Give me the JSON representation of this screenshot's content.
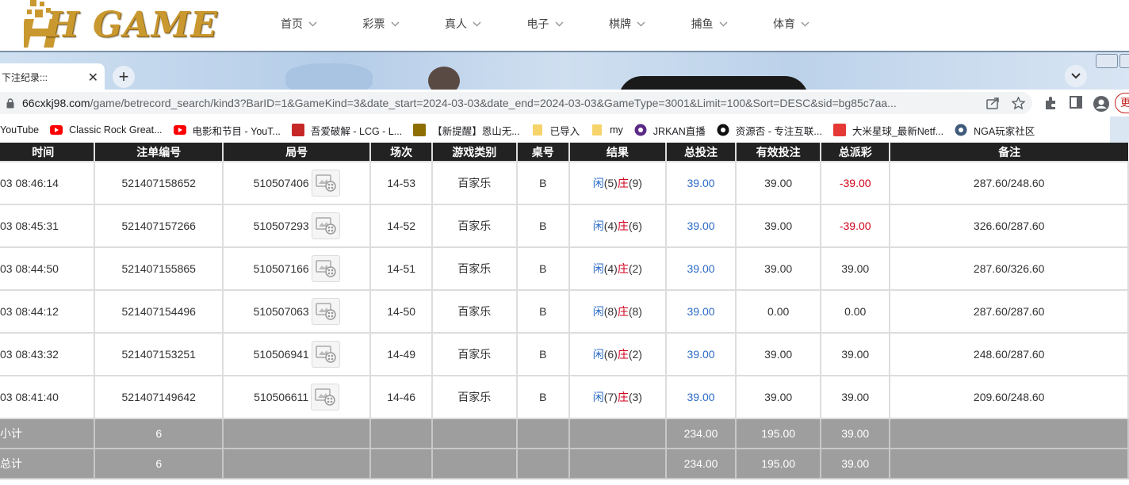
{
  "site": {
    "logo_text": "H GAME",
    "nav": [
      "首页",
      "彩票",
      "真人",
      "电子",
      "棋牌",
      "捕鱼",
      "体育"
    ]
  },
  "browser": {
    "tab_title": "下注纪录:::",
    "url_host": "66cxkj98.com",
    "url_path": "/game/betrecord_search/kind3?BarID=1&GameKind=3&date_start=2024-03-03&date_end=2024-03-03&GameType=3001&Limit=100&Sort=DESC&sid=bg85c7aa...",
    "profile_label": "更",
    "bookmarks": [
      {
        "icon": "youtube-icon",
        "label": "YouTube",
        "color": "#ff0000"
      },
      {
        "icon": "youtube-icon",
        "label": "Classic Rock Great...",
        "color": "#ff0000"
      },
      {
        "icon": "youtube-icon",
        "label": "电影和节目 - YouT...",
        "color": "#ff0000"
      },
      {
        "icon": "lcg-icon",
        "label": "吾爱破解 - LCG - L...",
        "color": "#c62828"
      },
      {
        "icon": "image-icon",
        "label": "【新提醒】恩山无...",
        "color": "#8d6e00"
      },
      {
        "icon": "folder-icon",
        "label": "已导入",
        "color": "#f6d36b"
      },
      {
        "icon": "folder-icon",
        "label": "my",
        "color": "#f6d36b"
      },
      {
        "icon": "jrkan-icon",
        "label": "JRKAN直播",
        "color": "#5b2a86"
      },
      {
        "icon": "resource-icon",
        "label": "资源否 - 专注互联...",
        "color": "#111111"
      },
      {
        "icon": "dami-icon",
        "label": "大米星球_最新Netf...",
        "color": "#e53935"
      },
      {
        "icon": "nga-icon",
        "label": "NGA玩家社区",
        "color": "#3f5a7a"
      }
    ]
  },
  "table": {
    "headers": [
      "时间",
      "注单编号",
      "局号",
      "场次",
      "游戏类别",
      "桌号",
      "结果",
      "总投注",
      "有效投注",
      "总派彩",
      "备注"
    ],
    "rows": [
      {
        "time": "03 08:46:14",
        "order": "521407158652",
        "round": "510507406",
        "session": "14-53",
        "game": "百家乐",
        "table": "B",
        "result": {
          "player": "闲",
          "p": "(5)",
          "banker": "庄",
          "b": "(9)"
        },
        "bet": "39.00",
        "valid": "39.00",
        "payout": "-39.00",
        "payout_neg": true,
        "note": "287.60/248.60"
      },
      {
        "time": "03 08:45:31",
        "order": "521407157266",
        "round": "510507293",
        "session": "14-52",
        "game": "百家乐",
        "table": "B",
        "result": {
          "player": "闲",
          "p": "(4)",
          "banker": "庄",
          "b": "(6)"
        },
        "bet": "39.00",
        "valid": "39.00",
        "payout": "-39.00",
        "payout_neg": true,
        "note": "326.60/287.60"
      },
      {
        "time": "03 08:44:50",
        "order": "521407155865",
        "round": "510507166",
        "session": "14-51",
        "game": "百家乐",
        "table": "B",
        "result": {
          "player": "闲",
          "p": "(4)",
          "banker": "庄",
          "b": "(2)"
        },
        "bet": "39.00",
        "valid": "39.00",
        "payout": "39.00",
        "payout_neg": false,
        "note": "287.60/326.60"
      },
      {
        "time": "03 08:44:12",
        "order": "521407154496",
        "round": "510507063",
        "session": "14-50",
        "game": "百家乐",
        "table": "B",
        "result": {
          "player": "闲",
          "p": "(8)",
          "banker": "庄",
          "b": "(8)"
        },
        "bet": "39.00",
        "valid": "0.00",
        "payout": "0.00",
        "payout_neg": false,
        "note": "287.60/287.60"
      },
      {
        "time": "03 08:43:32",
        "order": "521407153251",
        "round": "510506941",
        "session": "14-49",
        "game": "百家乐",
        "table": "B",
        "result": {
          "player": "闲",
          "p": "(6)",
          "banker": "庄",
          "b": "(2)"
        },
        "bet": "39.00",
        "valid": "39.00",
        "payout": "39.00",
        "payout_neg": false,
        "note": "248.60/287.60"
      },
      {
        "time": "03 08:41:40",
        "order": "521407149642",
        "round": "510506611",
        "session": "14-46",
        "game": "百家乐",
        "table": "B",
        "result": {
          "player": "闲",
          "p": "(7)",
          "banker": "庄",
          "b": "(3)"
        },
        "bet": "39.00",
        "valid": "39.00",
        "payout": "39.00",
        "payout_neg": false,
        "note": "209.60/248.60"
      }
    ],
    "subtotal": {
      "label": "小计",
      "count": "6",
      "bet": "234.00",
      "valid": "195.00",
      "payout": "39.00"
    },
    "total": {
      "label": "总计",
      "count": "6",
      "bet": "234.00",
      "valid": "195.00",
      "payout": "39.00"
    }
  },
  "colors": {
    "header_bg": "#222222",
    "sum_bg": "#9e9e9e",
    "blue": "#2b6bc7",
    "red": "#d0021b",
    "gold": "#c9982f"
  }
}
